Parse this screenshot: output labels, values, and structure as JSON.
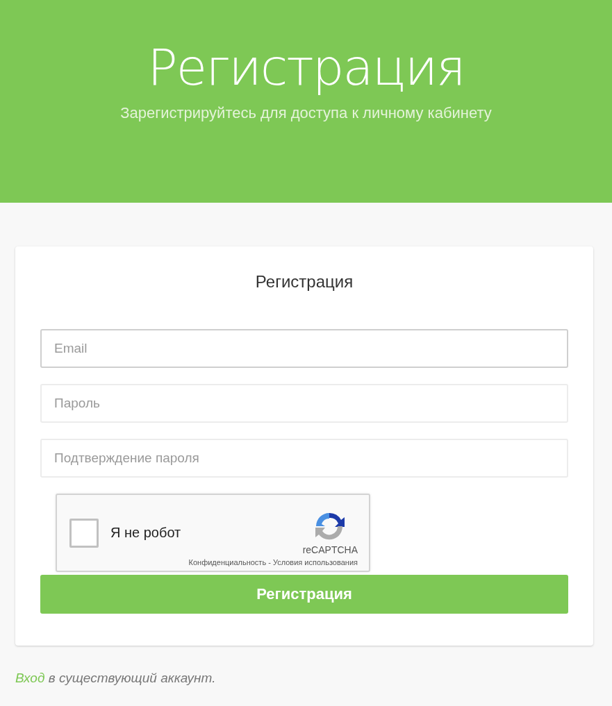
{
  "header": {
    "title": "Регистрация",
    "subtitle": "Зарегистрируйтесь для доступа к личному кабинету"
  },
  "form": {
    "title": "Регистрация",
    "fields": [
      {
        "placeholder": "Email",
        "focused": true
      },
      {
        "placeholder": "Пароль",
        "focused": false
      },
      {
        "placeholder": "Подтверждение пароля",
        "focused": false
      }
    ],
    "captcha": {
      "label": "Я не робот",
      "checked": false,
      "brand": "reCAPTCHA",
      "terms": "Конфиденциальность - Условия использования"
    },
    "submit": "Регистрация"
  },
  "footer": {
    "link": "Вход",
    "text": "в существующий аккаунт."
  }
}
